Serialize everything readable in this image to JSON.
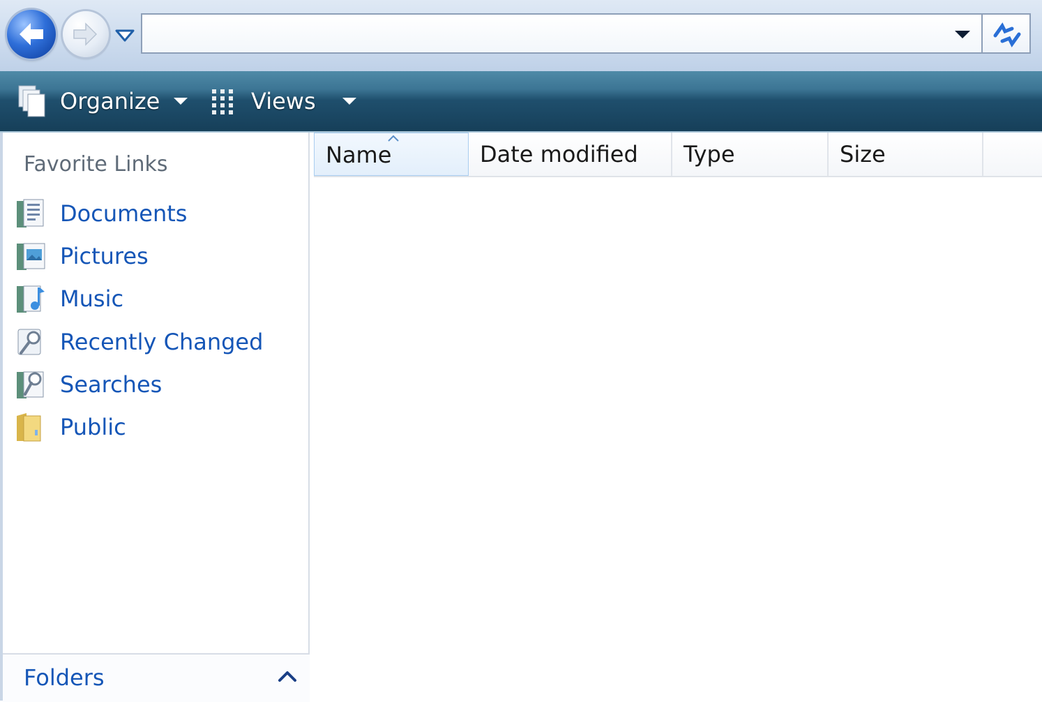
{
  "address_bar": {
    "path_value": "",
    "back_button_icon": "back-arrow-icon",
    "forward_button_icon": "forward-arrow-icon",
    "recent_pages_icon": "chevron-down-icon",
    "history_dropdown_icon": "dropdown-caret-icon",
    "refresh_icon": "refresh-icon"
  },
  "command_bar": {
    "organize_label": "Organize",
    "views_label": "Views"
  },
  "favorite_links": {
    "title": "Favorite Links",
    "items": [
      {
        "label": "Documents",
        "icon": "documents-folder-icon"
      },
      {
        "label": "Pictures",
        "icon": "pictures-folder-icon"
      },
      {
        "label": "Music",
        "icon": "music-folder-icon"
      },
      {
        "label": "Recently Changed",
        "icon": "recently-changed-icon"
      },
      {
        "label": "Searches",
        "icon": "searches-folder-icon"
      },
      {
        "label": "Public",
        "icon": "public-folder-icon"
      }
    ]
  },
  "folders_pane": {
    "label": "Folders",
    "toggle_icon": "chevron-up-icon"
  },
  "file_list": {
    "columns": [
      "Name",
      "Date modified",
      "Type",
      "Size"
    ],
    "sorted_column": "Name",
    "rows": []
  },
  "colors": {
    "link_blue": "#1556b7",
    "command_bar_dark": "#163f59",
    "command_bar_light": "#4f8aa7"
  }
}
